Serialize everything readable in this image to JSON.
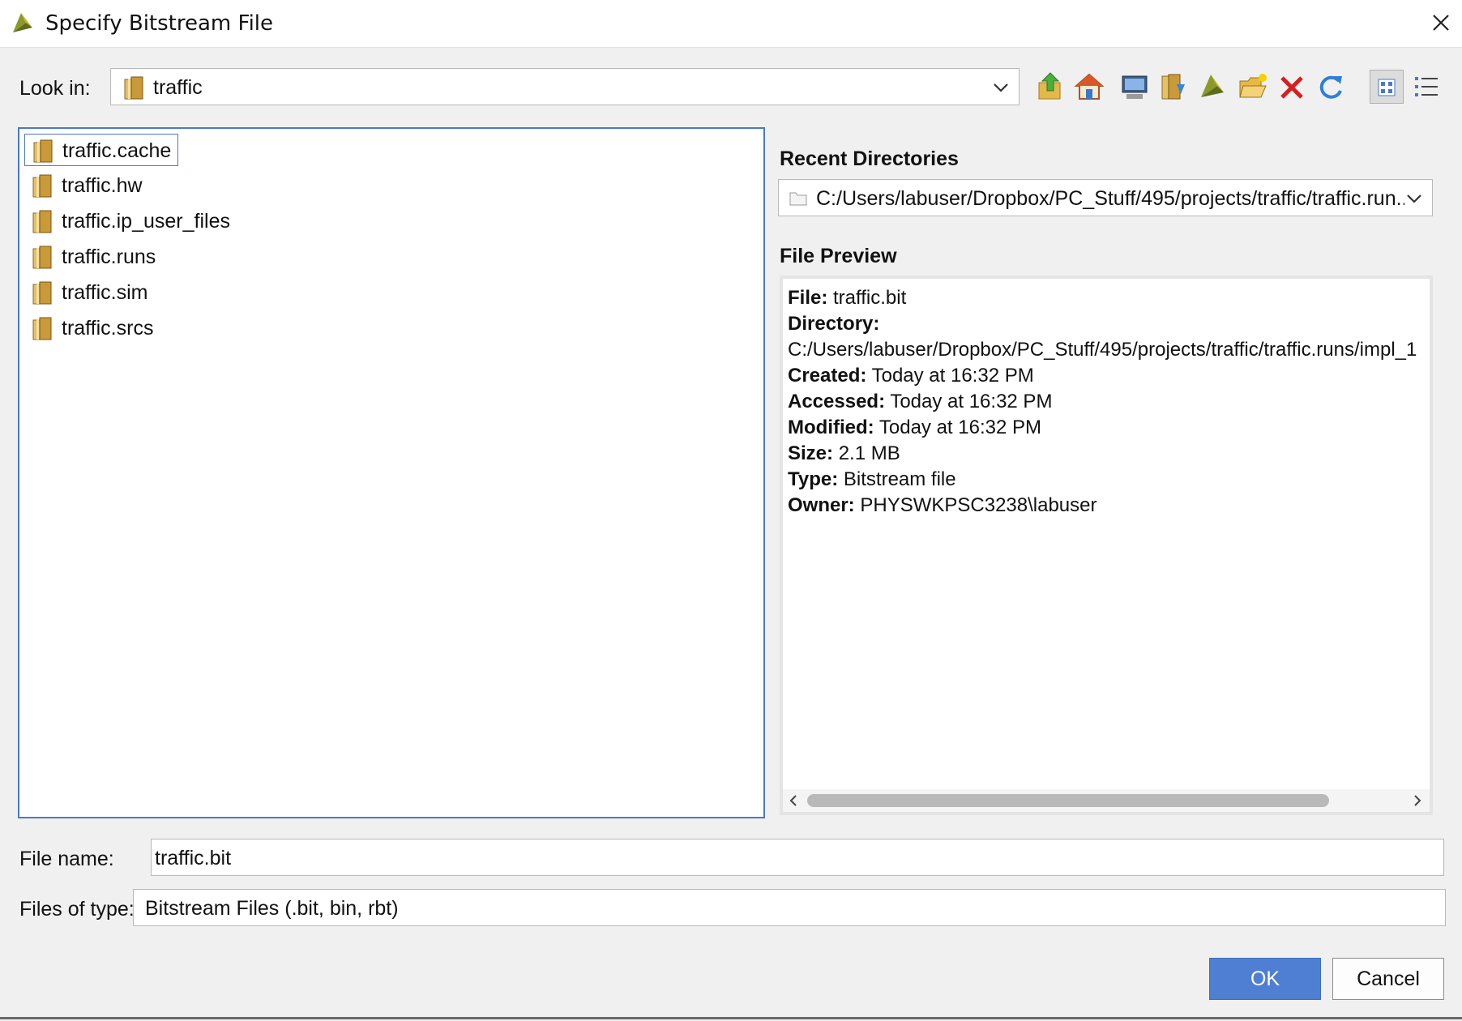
{
  "window": {
    "title": "Specify Bitstream File",
    "close_icon": "close-icon",
    "app_icon": "vivado-logo-icon"
  },
  "lookin": {
    "label": "Look in:",
    "value": "traffic"
  },
  "toolbar": {
    "icons": [
      "up-folder-icon",
      "home-icon",
      "desktop-icon",
      "bookmark-folder-icon",
      "vivado-project-icon",
      "new-folder-icon",
      "delete-icon",
      "refresh-icon",
      "list-view-icon",
      "details-view-icon"
    ]
  },
  "files": [
    {
      "name": "traffic.cache"
    },
    {
      "name": "traffic.hw"
    },
    {
      "name": "traffic.ip_user_files"
    },
    {
      "name": "traffic.runs"
    },
    {
      "name": "traffic.sim"
    },
    {
      "name": "traffic.srcs"
    }
  ],
  "recent": {
    "label": "Recent Directories",
    "value": "C:/Users/labuser/Dropbox/PC_Stuff/495/projects/traffic/traffic.run..."
  },
  "preview": {
    "label": "File Preview",
    "file_key": "File:",
    "file_val": "traffic.bit",
    "dir_key": "Directory:",
    "dir_val": "C:/Users/labuser/Dropbox/PC_Stuff/495/projects/traffic/traffic.runs/impl_1",
    "created_key": "Created:",
    "created_val": "Today at 16:32 PM",
    "accessed_key": "Accessed:",
    "accessed_val": "Today at 16:32 PM",
    "modified_key": "Modified:",
    "modified_val": "Today at 16:32 PM",
    "size_key": "Size:",
    "size_val": "2.1 MB",
    "type_key": "Type:",
    "type_val": "Bitstream file",
    "owner_key": "Owner:",
    "owner_val": "PHYSWKPSC3238\\labuser"
  },
  "filename": {
    "label": "File name:",
    "value": "traffic.bit"
  },
  "filetype": {
    "label": "Files of type:",
    "value": "Bitstream Files (.bit, bin, rbt)"
  },
  "buttons": {
    "ok": "OK",
    "cancel": "Cancel"
  },
  "colors": {
    "accent": "#4e7fd2",
    "selection_border": "#4a78c8",
    "folder": "#c8a040"
  }
}
